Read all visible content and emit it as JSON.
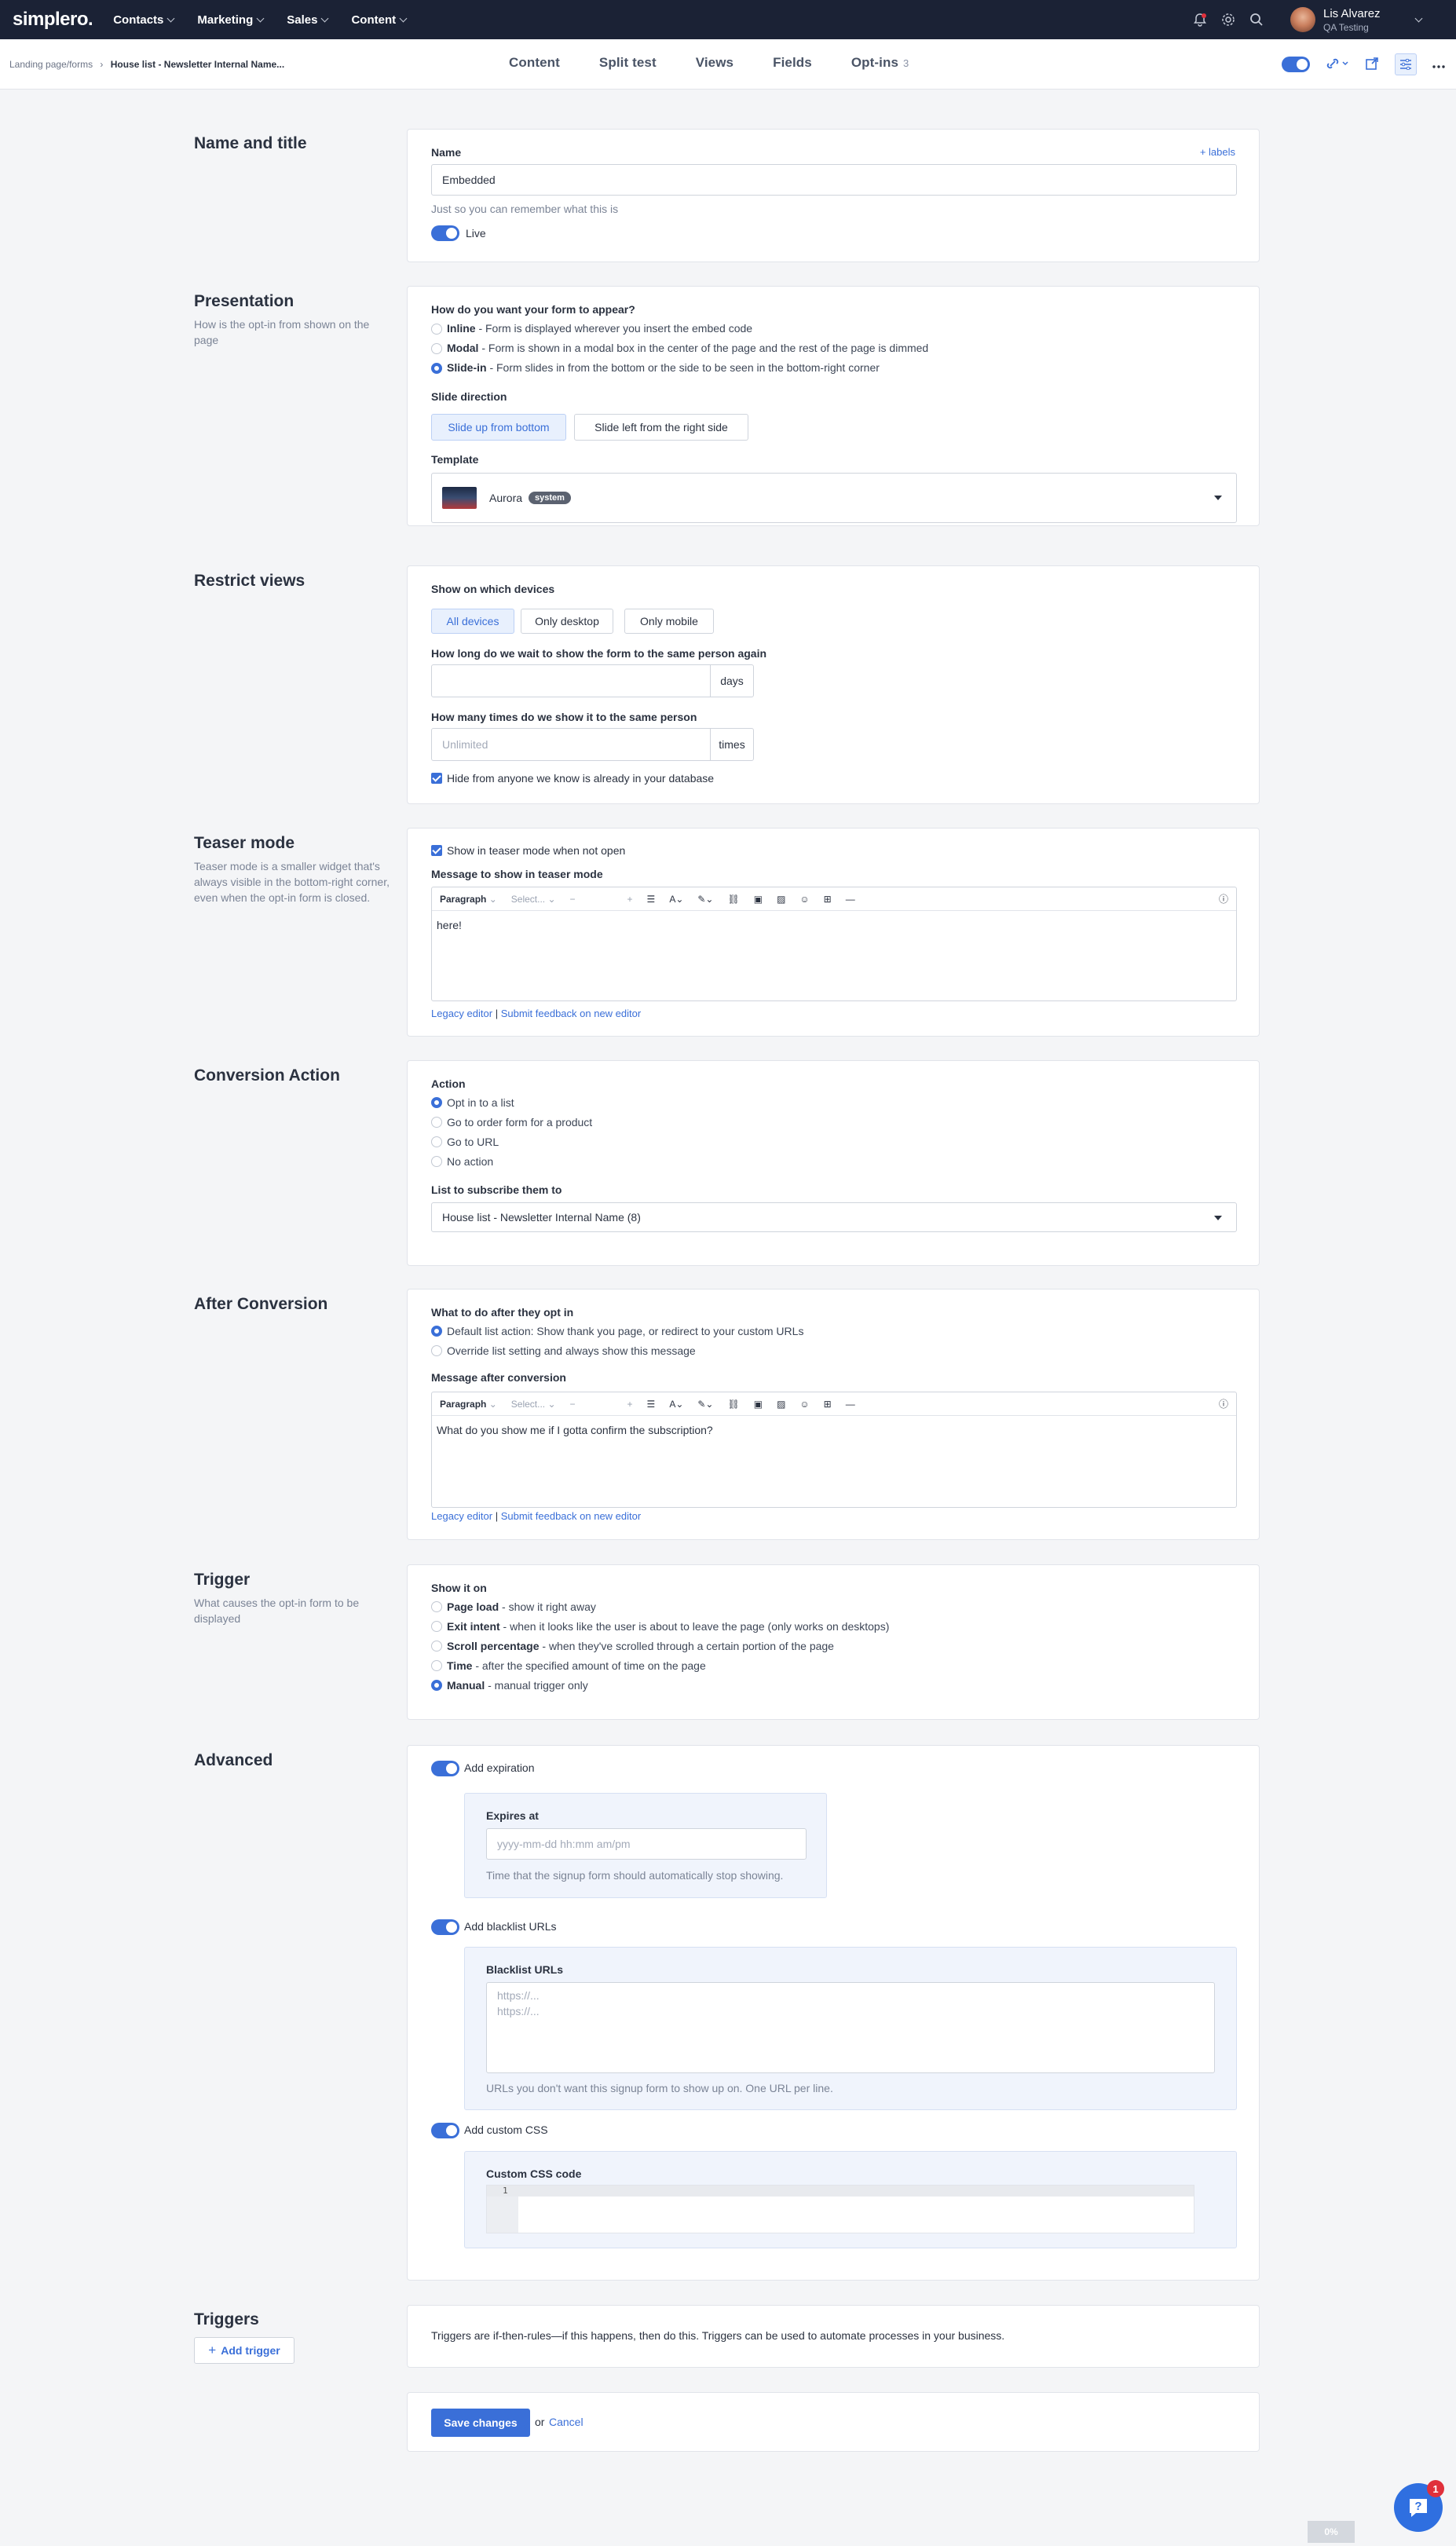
{
  "nav": {
    "logo": "simplero.",
    "items": [
      "Contacts",
      "Marketing",
      "Sales",
      "Content"
    ],
    "user_name": "Lis Alvarez",
    "user_org": "QA Testing"
  },
  "subnav": {
    "crumb_root": "Landing page/forms",
    "crumb_sep": "›",
    "crumb_current": "House list - Newsletter Internal Name...",
    "tabs": [
      "Content",
      "Split test",
      "Views",
      "Fields",
      "Opt-ins"
    ],
    "optins_count": "3"
  },
  "name_section": {
    "title": "Name and title",
    "name_label": "Name",
    "labels_link": "+ labels",
    "name_value": "Embedded",
    "hint": "Just so you can remember what this is",
    "live_label": "Live"
  },
  "presentation": {
    "title": "Presentation",
    "desc": "How is the opt-in from shown on the page",
    "question": "How do you want your form to appear?",
    "options": [
      {
        "name": "Inline",
        "desc": " - Form is displayed wherever you insert the embed code"
      },
      {
        "name": "Modal",
        "desc": " - Form is shown in a modal box in the center of the page and the rest of the page is dimmed"
      },
      {
        "name": "Slide-in",
        "desc": " - Form slides in from the bottom or the side to be seen in the bottom-right corner"
      }
    ],
    "slide_label": "Slide direction",
    "slide_buttons": [
      "Slide up from bottom",
      "Slide left from the right side"
    ],
    "template_label": "Template",
    "template_name": "Aurora",
    "template_badge": "system"
  },
  "restrict": {
    "title": "Restrict views",
    "devices_label": "Show on which devices",
    "devices": [
      "All devices",
      "Only desktop",
      "Only mobile"
    ],
    "wait_label": "How long do we wait to show the form to the same person again",
    "wait_unit": "days",
    "times_label": "How many times do we show it to the same person",
    "times_placeholder": "Unlimited",
    "times_unit": "times",
    "hide_label": "Hide from anyone we know is already in your database"
  },
  "teaser": {
    "title": "Teaser mode",
    "desc": "Teaser mode is a smaller widget that's always visible in the bottom-right corner, even when the opt-in form is closed.",
    "check_label": "Show in teaser mode when not open",
    "msg_label": "Message to show in teaser mode",
    "editor_text": "here!",
    "legacy": "Legacy editor",
    "sep": "|",
    "feedback": "Submit feedback on new editor"
  },
  "editor_toolbar": {
    "paragraph": "Paragraph",
    "select": "Select...",
    "minus": "−",
    "plus": "+"
  },
  "conversion": {
    "title": "Conversion Action",
    "action_label": "Action",
    "options": [
      "Opt in to a list",
      "Go to order form for a product",
      "Go to URL",
      "No action"
    ],
    "list_label": "List to subscribe them to",
    "list_value": "House list - Newsletter Internal Name (8)"
  },
  "after": {
    "title": "After Conversion",
    "question": "What to do after they opt in",
    "options": [
      "Default list action: Show thank you page, or redirect to your custom URLs",
      "Override list setting and always show this message"
    ],
    "msg_label": "Message after conversion",
    "editor_text": "What do you show me if I gotta confirm the subscription?",
    "legacy": "Legacy editor",
    "sep": "|",
    "feedback": "Submit feedback on new editor"
  },
  "trigger": {
    "title": "Trigger",
    "desc": "What causes the opt-in form to be displayed",
    "show_label": "Show it on",
    "options": [
      {
        "name": "Page load",
        "desc": " - show it right away"
      },
      {
        "name": "Exit intent",
        "desc": " - when it looks like the user is about to leave the page (only works on desktops)"
      },
      {
        "name": "Scroll percentage",
        "desc": " - when they've scrolled through a certain portion of the page"
      },
      {
        "name": "Time",
        "desc": " - after the specified amount of time on the page"
      },
      {
        "name": "Manual",
        "desc": " - manual trigger only"
      }
    ]
  },
  "advanced": {
    "title": "Advanced",
    "expiration_label": "Add expiration",
    "expires_label": "Expires at",
    "expires_placeholder": "yyyy-mm-dd hh:mm am/pm",
    "expires_hint": "Time that the signup form should automatically stop showing.",
    "blacklist_toggle": "Add blacklist URLs",
    "blacklist_label": "Blacklist URLs",
    "blacklist_placeholder1": "https://...",
    "blacklist_placeholder2": "https://...",
    "blacklist_hint": "URLs you don't want this signup form to show up on. One URL per line.",
    "css_toggle": "Add custom CSS",
    "css_label": "Custom CSS code",
    "css_line": "1"
  },
  "triggers": {
    "title": "Triggers",
    "add_button": "Add trigger",
    "desc": "Triggers are if-then-rules—if this happens, then do this. Triggers can be used to automate processes in your business."
  },
  "footer": {
    "save": "Save changes",
    "or": "or",
    "cancel": "Cancel"
  },
  "widgets": {
    "help_badge": "1",
    "progress": "0%"
  },
  "colors": {
    "accent": "#3a6fd8",
    "nav_bg": "#1b2235",
    "page_bg": "#f4f5f7"
  }
}
